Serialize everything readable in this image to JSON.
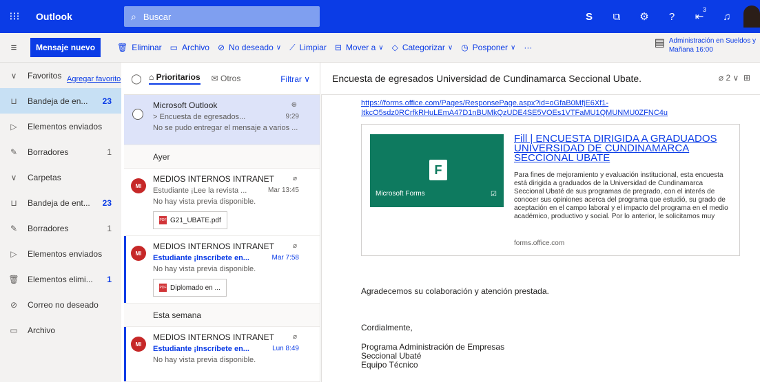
{
  "app": {
    "name": "Outlook"
  },
  "search": {
    "placeholder": "Buscar"
  },
  "top_icons": [
    "skype-icon",
    "myday-icon",
    "gear-icon",
    "help-icon",
    "feedback-icon",
    "bell-icon"
  ],
  "feedback_count": "3",
  "commands": {
    "new_mail": "Mensaje nuevo",
    "items": [
      {
        "label": "Eliminar",
        "icon": "trash"
      },
      {
        "label": "Archivo",
        "icon": "archive"
      },
      {
        "label": "No deseado",
        "icon": "block",
        "dropdown": true
      },
      {
        "label": "Limpiar",
        "icon": "broom"
      },
      {
        "label": "Mover a",
        "icon": "move",
        "dropdown": true
      },
      {
        "label": "Categorizar",
        "icon": "tag",
        "dropdown": true
      },
      {
        "label": "Posponer",
        "icon": "clock",
        "dropdown": true
      }
    ],
    "more": "···",
    "reminder": {
      "title": "Administración en Sueldos y",
      "time": "Mañana 16:00"
    }
  },
  "nav": {
    "favorites_header": "Favoritos",
    "favorites": [
      {
        "label": "Bandeja de en...",
        "count": "23",
        "icon": "inbox"
      },
      {
        "label": "Elementos enviados",
        "count": "",
        "icon": "sent"
      },
      {
        "label": "Borradores",
        "count": "1",
        "icon": "draft"
      }
    ],
    "add_favorite": "Agregar favorito",
    "folders_header": "Carpetas",
    "folders": [
      {
        "label": "Bandeja de ent...",
        "count": "23",
        "icon": "inbox"
      },
      {
        "label": "Borradores",
        "count": "1",
        "icon": "draft"
      },
      {
        "label": "Elementos enviados",
        "count": "",
        "icon": "sent"
      },
      {
        "label": "Elementos elimi...",
        "count": "1",
        "icon": "trash"
      },
      {
        "label": "Correo no deseado",
        "count": "",
        "icon": "block"
      },
      {
        "label": "Archivo",
        "count": "",
        "icon": "archive"
      }
    ]
  },
  "list": {
    "tab_focused": "Prioritarios",
    "tab_other": "Otros",
    "filter": "Filtrar",
    "messages": [
      {
        "sender": "Microsoft Outlook",
        "subject": "> Encuesta de egresados...",
        "time": "9:29",
        "preview": "No se pudo entregar el mensaje a varios ..."
      },
      {
        "group": "Ayer"
      },
      {
        "sender": "MEDIOS INTERNOS INTRANET",
        "subject": "Estudiante ¡Lee la revista ...",
        "time": "Mar 13:45",
        "preview": "No hay vista previa disponible.",
        "attachment": "G21_UBATE.pdf",
        "avatar": "MI"
      },
      {
        "sender": "MEDIOS INTERNOS INTRANET",
        "subject": "Estudiante ¡Inscríbete en...",
        "time": "Mar 7:58",
        "preview": "No hay vista previa disponible.",
        "attachment": "Diplomado en ...",
        "avatar": "MI"
      },
      {
        "group": "Esta semana"
      },
      {
        "sender": "MEDIOS INTERNOS INTRANET",
        "subject": "Estudiante ¡Inscríbete en...",
        "time": "Lun 8:49",
        "preview": "No hay vista previa disponible.",
        "avatar": "MI"
      }
    ]
  },
  "reading": {
    "subject": "Encuesta de egresados Universidad de Cundinamarca Seccional Ubate.",
    "attachment_count": "2",
    "link_url": "https://forms.office.com/Pages/ResponsePage.aspx?id=oGfaB0MfjE6Xf1-ItkcO5sdz0RCrfkRHuLEmA47D1nBUMkQzUDE4SE5VOEs1VTFaMU1QMUNMU0ZFNC4u",
    "card": {
      "image_label": "Microsoft Forms",
      "title": "Fill | ENCUESTA DIRIGIDA A GRADUADOS UNIVERSIDAD DE CUNDINAMARCA SECCIONAL UBATE",
      "description": "Para fines de mejoramiento y evaluación institucional, esta encuesta está dirigida a graduados de la Universidad de Cundinamarca Seccional Ubaté de sus programas de pregrado, con el interés de conocer sus opiniones acerca del programa que estudió, su grado de aceptación en el campo laboral y el impacto del programa en el medio académico, productivo y social. Por lo anterior, le solicitamos muy",
      "domain": "forms.office.com"
    },
    "thanks": "Agradecemos su colaboración y atención prestada.",
    "closing": "Cordialmente,",
    "signature": [
      "Programa Administración de Empresas",
      "Seccional Ubaté",
      "Equipo Técnico"
    ]
  }
}
